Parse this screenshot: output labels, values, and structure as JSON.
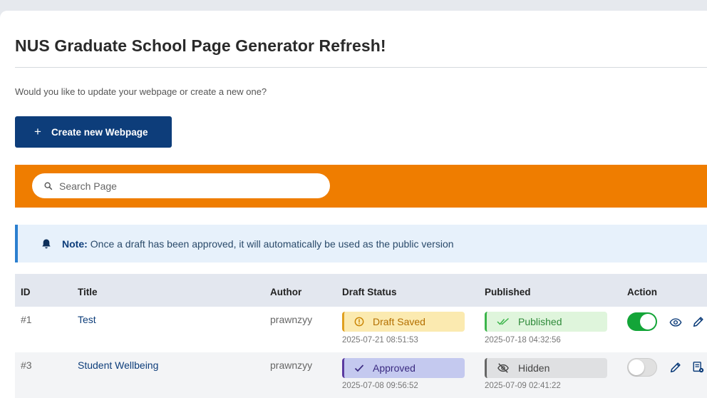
{
  "page": {
    "title": "NUS Graduate School Page Generator Refresh!",
    "subtitle": "Would you like to update your webpage or create a new one?",
    "create_button_label": "Create new Webpage"
  },
  "search": {
    "placeholder": "Search Page",
    "value": ""
  },
  "note": {
    "label": "Note:",
    "text": "Once a draft has been approved, it will automatically be used as the public version"
  },
  "table": {
    "headers": {
      "id": "ID",
      "title": "Title",
      "author": "Author",
      "draft_status": "Draft Status",
      "published": "Published",
      "action": "Action"
    },
    "rows": [
      {
        "id": "#1",
        "title": "Test",
        "author": "prawnzyy",
        "draft_status": "Draft Saved",
        "draft_time": "2025-07-21 08:51:53",
        "published_status": "Published",
        "published_time": "2025-07-18 04:32:56",
        "toggle_on": true
      },
      {
        "id": "#3",
        "title": "Student Wellbeing",
        "author": "prawnzyy",
        "draft_status": "Approved",
        "draft_time": "2025-07-08 09:56:52",
        "published_status": "Hidden",
        "published_time": "2025-07-09 02:41:22",
        "toggle_on": false
      }
    ]
  },
  "colors": {
    "primary": "#0d3d7a",
    "accent_orange": "#ef7d00",
    "toggle_on": "#13a538",
    "note_border": "#2b7fcf"
  },
  "icons": [
    "plus-icon",
    "search-icon",
    "bell-icon",
    "warning-circle-icon",
    "double-check-icon",
    "check-icon",
    "eye-off-icon",
    "eye-icon",
    "pencil-icon",
    "document-settings-icon"
  ]
}
